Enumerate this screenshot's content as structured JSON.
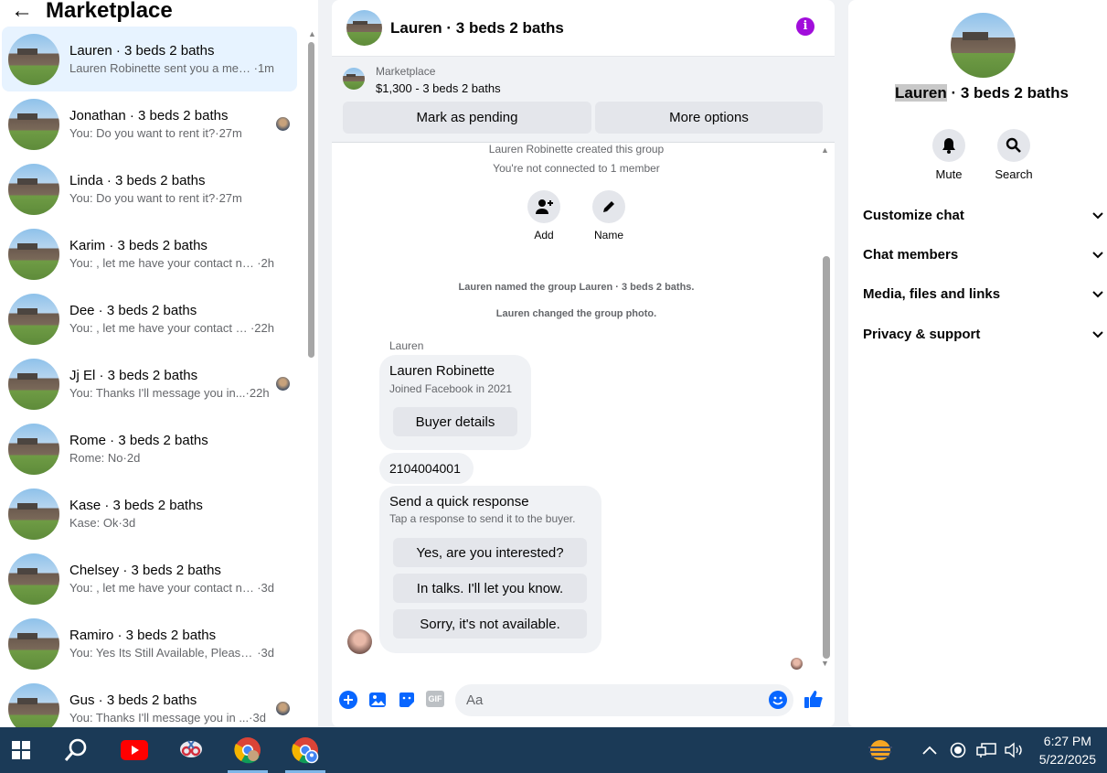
{
  "left": {
    "back_label": "←",
    "title": "Marketplace",
    "conversations": [
      {
        "name": "Lauren · 3 beds 2 baths",
        "preview": "Lauren Robinette sent you a messa...",
        "time": "·1m",
        "active": true
      },
      {
        "name": "Jonathan · 3 beds 2 baths",
        "preview": "You: Do you want to rent it?",
        "time": "·27m",
        "read": true
      },
      {
        "name": "Linda · 3 beds 2 baths",
        "preview": "You: Do you want to rent it?",
        "time": "·27m"
      },
      {
        "name": "Karim · 3 beds 2 baths",
        "preview": "You: , let me have your contact nu...",
        "time": "·2h"
      },
      {
        "name": "Dee · 3 beds 2 baths",
        "preview": "You: , let me have your contact nu...",
        "time": "·22h"
      },
      {
        "name": "Jj El · 3 beds 2 baths",
        "preview": "You: Thanks I'll message you in...",
        "time": "·22h",
        "read": true
      },
      {
        "name": "Rome · 3 beds 2 baths",
        "preview": "Rome: No",
        "time": "·2d"
      },
      {
        "name": "Kase · 3 beds 2 baths",
        "preview": "Kase: Ok",
        "time": "·3d"
      },
      {
        "name": "Chelsey · 3 beds 2 baths",
        "preview": "You: , let me have your contact nu...",
        "time": "·3d"
      },
      {
        "name": "Ramiro · 3 beds 2 baths",
        "preview": "You: Yes Its Still Available, Please Se...",
        "time": "·3d"
      },
      {
        "name": "Gus · 3 beds 2 baths",
        "preview": "You: Thanks I'll message you in ...",
        "time": "·3d",
        "read": true
      }
    ]
  },
  "center": {
    "title": "Lauren · 3 beds 2 baths",
    "info_icon": "i",
    "banner": {
      "source": "Marketplace",
      "listing": "$1,300 - 3 beds 2 baths",
      "pending_label": "Mark as pending",
      "more_label": "More options"
    },
    "system": {
      "created": "Lauren Robinette created this group",
      "not_connected": "You're not connected to 1 member",
      "add_label": "Add",
      "name_label": "Name",
      "named": "Lauren named the group Lauren · 3 beds 2 baths.",
      "changed_photo": "Lauren changed the group photo."
    },
    "messages": {
      "sender": "Lauren",
      "card_name": "Lauren Robinette",
      "card_sub": "Joined Facebook in 2021",
      "card_button": "Buyer details",
      "phone": "2104004001",
      "quick_title": "Send a quick response",
      "quick_sub": "Tap a response to send it to the buyer.",
      "quick_options": [
        "Yes, are you interested?",
        "In talks. I'll let you know.",
        "Sorry, it's not available."
      ]
    },
    "compose": {
      "placeholder": "Aa",
      "gif_label": "GIF"
    }
  },
  "right": {
    "title_highlight": "Lauren",
    "title_rest": " · 3 beds 2 baths",
    "mute_label": "Mute",
    "search_label": "Search",
    "sections": [
      "Customize chat",
      "Chat members",
      "Media, files and links",
      "Privacy & support"
    ]
  },
  "taskbar": {
    "time": "6:27 PM",
    "date": "5/22/2025"
  },
  "colors": {
    "accent": "#0866ff",
    "info": "#a10ddb",
    "taskbar": "#1b3a57"
  }
}
